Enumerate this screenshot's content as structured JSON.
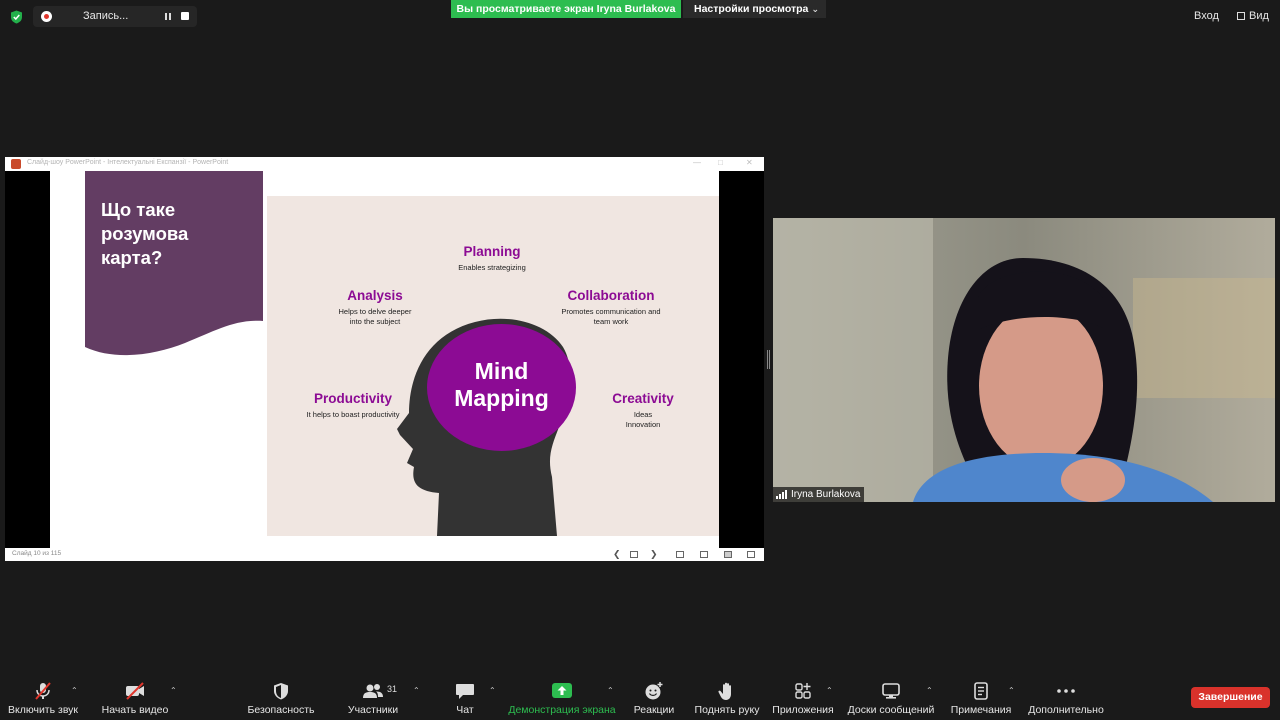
{
  "topbar": {
    "recording_label": "Запись...",
    "viewing_banner": "Вы просматриваете экран Iryna Burlakova",
    "view_settings": "Настройки просмотра",
    "enter_label": "Вход",
    "view_label": "Вид"
  },
  "shared_window": {
    "title": "Слайд-шоу PowerPoint - Інтелектуальні Експанзії - PowerPoint",
    "slide_status": "Слайд 10 из 115"
  },
  "slide": {
    "title": "Що таке розумова карта?",
    "center": "Mind Mapping",
    "nodes": [
      {
        "heading": "Planning",
        "desc": "Enables strategizing"
      },
      {
        "heading": "Analysis",
        "desc": "Helps to delve deeper into the subject"
      },
      {
        "heading": "Collaboration",
        "desc": "Promotes communication and team work"
      },
      {
        "heading": "Productivity",
        "desc": "It helps to boast productivity"
      },
      {
        "heading": "Creativity",
        "desc": "Ideas Innovation"
      }
    ],
    "colors": {
      "accent": "#8c0b94",
      "panel": "#633d63",
      "background": "#f0e6e1",
      "head": "#333333"
    }
  },
  "participant": {
    "name": "Iryna Burlakova"
  },
  "toolbar": {
    "items": [
      {
        "label": "Включить звук",
        "icon": "muted-mic-icon"
      },
      {
        "label": "Начать видео",
        "icon": "video-off-icon"
      },
      {
        "label": "Безопасность",
        "icon": "shield-icon"
      },
      {
        "label": "Участники",
        "icon": "participants-icon",
        "count": "31"
      },
      {
        "label": "Чат",
        "icon": "chat-icon"
      },
      {
        "label": "Демонстрация экрана",
        "icon": "share-screen-icon"
      },
      {
        "label": "Реакции",
        "icon": "reactions-icon"
      },
      {
        "label": "Поднять руку",
        "icon": "raise-hand-icon"
      },
      {
        "label": "Приложения",
        "icon": "apps-icon"
      },
      {
        "label": "Доски сообщений",
        "icon": "whiteboard-icon"
      },
      {
        "label": "Примечания",
        "icon": "notes-icon"
      },
      {
        "label": "Дополнительно",
        "icon": "more-icon"
      }
    ],
    "end_label": "Завершение",
    "colors": {
      "share_green": "#2dbd50",
      "end_red": "#d9322b"
    }
  }
}
